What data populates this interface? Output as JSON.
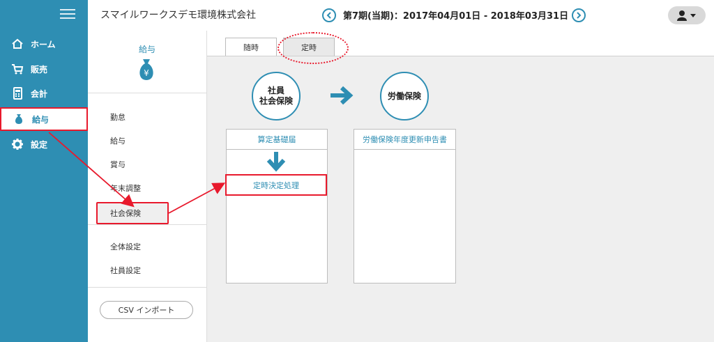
{
  "colors": {
    "brand": "#2e8eb3",
    "highlight": "#e8192c",
    "content_bg": "#efefef"
  },
  "header": {
    "company": "スマイルワークスデモ環境株式会社",
    "period": "第7期(当期)：2017年04月01日 - 2018年03月31日",
    "prev_icon": "chevron-left-icon",
    "next_icon": "chevron-right-icon",
    "user_icon": "user-icon"
  },
  "sidebar": {
    "menu_icon": "hamburger-icon",
    "items": [
      {
        "label": "ホーム",
        "icon": "home-icon"
      },
      {
        "label": "販売",
        "icon": "cart-icon"
      },
      {
        "label": "会計",
        "icon": "calculator-icon"
      },
      {
        "label": "給与",
        "icon": "money-bag-icon",
        "active": true
      },
      {
        "label": "設定",
        "icon": "gear-icon"
      }
    ]
  },
  "subnav": {
    "title": "給与",
    "icon": "yen-bag-icon",
    "groups": [
      [
        "勤怠",
        "給与",
        "賞与",
        "年末調整",
        "社会保険"
      ],
      [
        "全体設定",
        "社員設定"
      ]
    ],
    "active": "社会保険",
    "csv_button": "CSV インポート"
  },
  "tabs": [
    {
      "label": "随時",
      "active": false
    },
    {
      "label": "定時",
      "active": true
    }
  ],
  "flow": {
    "left_circle": [
      "社員",
      "社会保険"
    ],
    "right_circle": "労働保険",
    "left_panel": {
      "title": "算定基礎届",
      "item": "定時決定処理"
    },
    "right_panel": {
      "title": "労働保険年度更新申告書"
    }
  }
}
